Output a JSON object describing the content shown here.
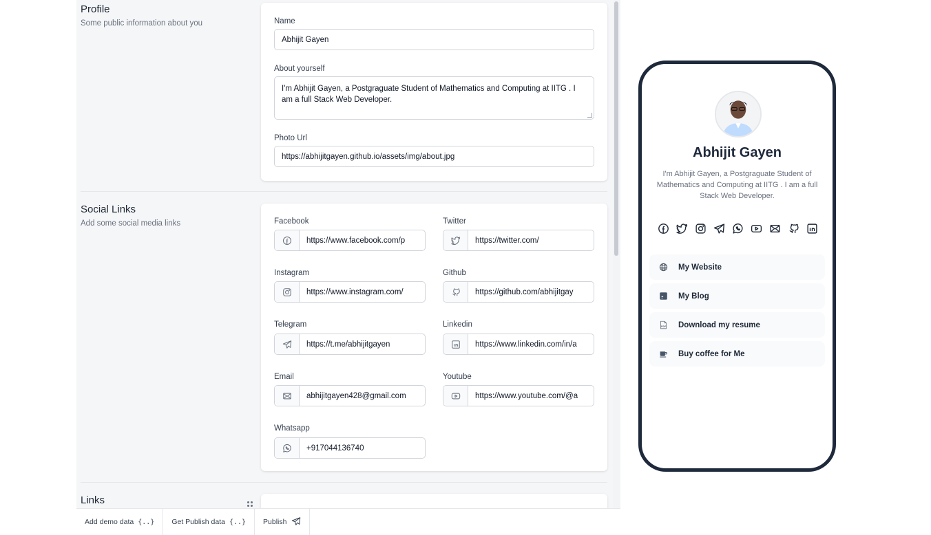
{
  "profile": {
    "title": "Profile",
    "subtitle": "Some public information about you",
    "name_label": "Name",
    "name_value": "Abhijit Gayen",
    "about_label": "About yourself",
    "about_value": "I'm Abhijit Gayen, a Postgraguate Student of Mathematics and Computing at IITG . I am a full Stack Web Developer.",
    "photo_label": "Photo Url",
    "photo_value": "https://abhijitgayen.github.io/assets/img/about.jpg"
  },
  "social": {
    "title": "Social Links",
    "subtitle": "Add some social media links",
    "fields": [
      {
        "label": "Facebook",
        "value": "https://www.facebook.com/p",
        "icon": "facebook-icon"
      },
      {
        "label": "Twitter",
        "value": "https://twitter.com/",
        "icon": "twitter-icon"
      },
      {
        "label": "Instagram",
        "value": "https://www.instagram.com/",
        "icon": "instagram-icon"
      },
      {
        "label": "Github",
        "value": "https://github.com/abhijitgay",
        "icon": "github-icon"
      },
      {
        "label": "Telegram",
        "value": "https://t.me/abhijitgayen",
        "icon": "telegram-icon"
      },
      {
        "label": "Linkedin",
        "value": "https://www.linkedin.com/in/a",
        "icon": "linkedin-icon"
      },
      {
        "label": "Email",
        "value": "abhijitgayen428@gmail.com",
        "icon": "email-icon"
      },
      {
        "label": "Youtube",
        "value": "https://www.youtube.com/@a",
        "icon": "youtube-icon"
      },
      {
        "label": "Whatsapp",
        "value": "+917044136740",
        "icon": "whatsapp-icon"
      }
    ]
  },
  "links": {
    "title": "Links"
  },
  "toolbar": {
    "add_demo": "Add demo data",
    "add_demo_icon": "{..}",
    "get_publish": "Get Publish data",
    "get_publish_icon": "{..}",
    "publish": "Publish"
  },
  "preview": {
    "name": "Abhijit Gayen",
    "bio": "I'm Abhijit Gayen, a Postgraguate Student of Mathematics and Computing at IITG . I am a full Stack Web Developer.",
    "social_icons": [
      "facebook-icon",
      "twitter-icon",
      "instagram-icon",
      "telegram-icon",
      "whatsapp-icon",
      "youtube-icon",
      "email-icon",
      "github-icon",
      "linkedin-icon"
    ],
    "links": [
      {
        "label": "My Website",
        "icon": "globe-icon"
      },
      {
        "label": "My Blog",
        "icon": "blog-icon"
      },
      {
        "label": "Download my resume",
        "icon": "pdf-icon"
      },
      {
        "label": "Buy coffee for Me",
        "icon": "coffee-icon"
      }
    ]
  },
  "colors": {
    "editor_bg": "#f5f6f7",
    "phone_frame": "#1e293b",
    "link_bg": "#f8fafc"
  }
}
